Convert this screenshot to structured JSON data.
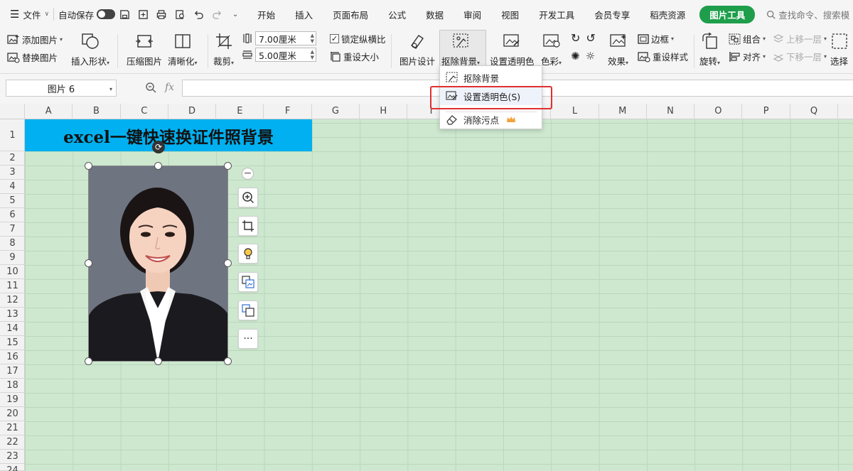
{
  "menubar": {
    "file_label": "文件",
    "autosave_label": "自动保存",
    "tabs": [
      "开始",
      "插入",
      "页面布局",
      "公式",
      "数据",
      "审阅",
      "视图",
      "开发工具",
      "会员专享",
      "稻壳资源"
    ],
    "picture_tools_label": "图片工具",
    "search_placeholder": "查找命令、搜索模"
  },
  "ribbon": {
    "add_picture": "添加图片",
    "replace_picture": "替换图片",
    "insert_shape": "插入形状",
    "compress_picture": "压缩图片",
    "sharpen": "清晰化",
    "crop": "裁剪",
    "width_value": "7.00厘米",
    "height_value": "5.00厘米",
    "lock_ratio": "锁定纵横比",
    "lock_ratio_checked": true,
    "reset_size": "重设大小",
    "picture_design": "图片设计",
    "remove_background": "抠除背景",
    "set_transparent": "设置透明色",
    "color": "色彩",
    "effects": "效果",
    "border": "边框",
    "reset_style": "重设样式",
    "rotate": "旋转",
    "group": "组合",
    "align": "对齐",
    "bring_forward": "上移一层",
    "send_backward": "下移一层",
    "select": "选择"
  },
  "formula_bar": {
    "name_box": "图片 6",
    "fx_label": "fx",
    "formula": ""
  },
  "sheet": {
    "columns": [
      "A",
      "B",
      "C",
      "D",
      "E",
      "F",
      "G",
      "H",
      "I",
      "J",
      "K",
      "L",
      "M",
      "N",
      "O",
      "P",
      "Q"
    ],
    "rows": [
      "1",
      "2",
      "3",
      "4",
      "5",
      "6",
      "7",
      "8",
      "9",
      "10",
      "11",
      "12",
      "13",
      "14",
      "15",
      "16",
      "17",
      "18",
      "19",
      "20",
      "21",
      "22",
      "23",
      "24"
    ],
    "title_cell": "excel一键快速换证件照背景"
  },
  "dropdown": {
    "items": [
      {
        "label": "抠除背景",
        "icon": "remove-background-icon"
      },
      {
        "label": "设置透明色(S)",
        "icon": "transparent-color-icon"
      },
      {
        "label": "消除污点",
        "icon": "eraser-icon",
        "badge": "crown-icon"
      }
    ]
  },
  "side_toolbar": {
    "more_label": "···"
  },
  "colors": {
    "accent_green": "#1e9e4b",
    "title_fill": "#00b0f0",
    "sheet_bg": "#cde8cf",
    "highlight_box": "#e03030"
  }
}
